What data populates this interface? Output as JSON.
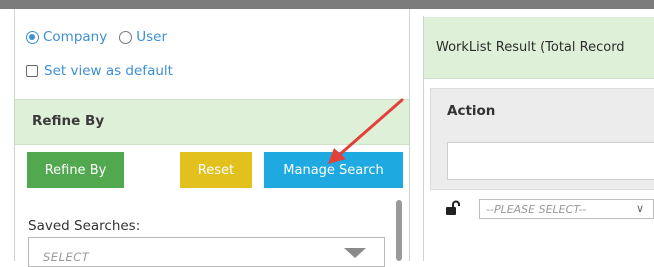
{
  "view_options": {
    "company_label": "Company",
    "user_label": "User",
    "default_label": "Set view as default",
    "selected": "Company"
  },
  "refine": {
    "header": "Refine By",
    "refine_button": "Refine By",
    "reset_button": "Reset",
    "manage_button": "Manage Search"
  },
  "saved_searches": {
    "label": "Saved Searches:",
    "value": "SELECT"
  },
  "worklist": {
    "title": "WorkList Result (Total Record",
    "action_header": "Action",
    "row_select": "--PLEASE SELECT--"
  },
  "colors": {
    "header_green": "#dff0d8",
    "refine_green": "#52a84f",
    "reset_yellow": "#e2c01d",
    "manage_blue": "#1ea9e0",
    "arrow_red": "#e2403a"
  },
  "icons": {
    "lock": "unlock-icon",
    "dropdown": "caret-down-icon",
    "annotation": "red-arrow-icon"
  }
}
